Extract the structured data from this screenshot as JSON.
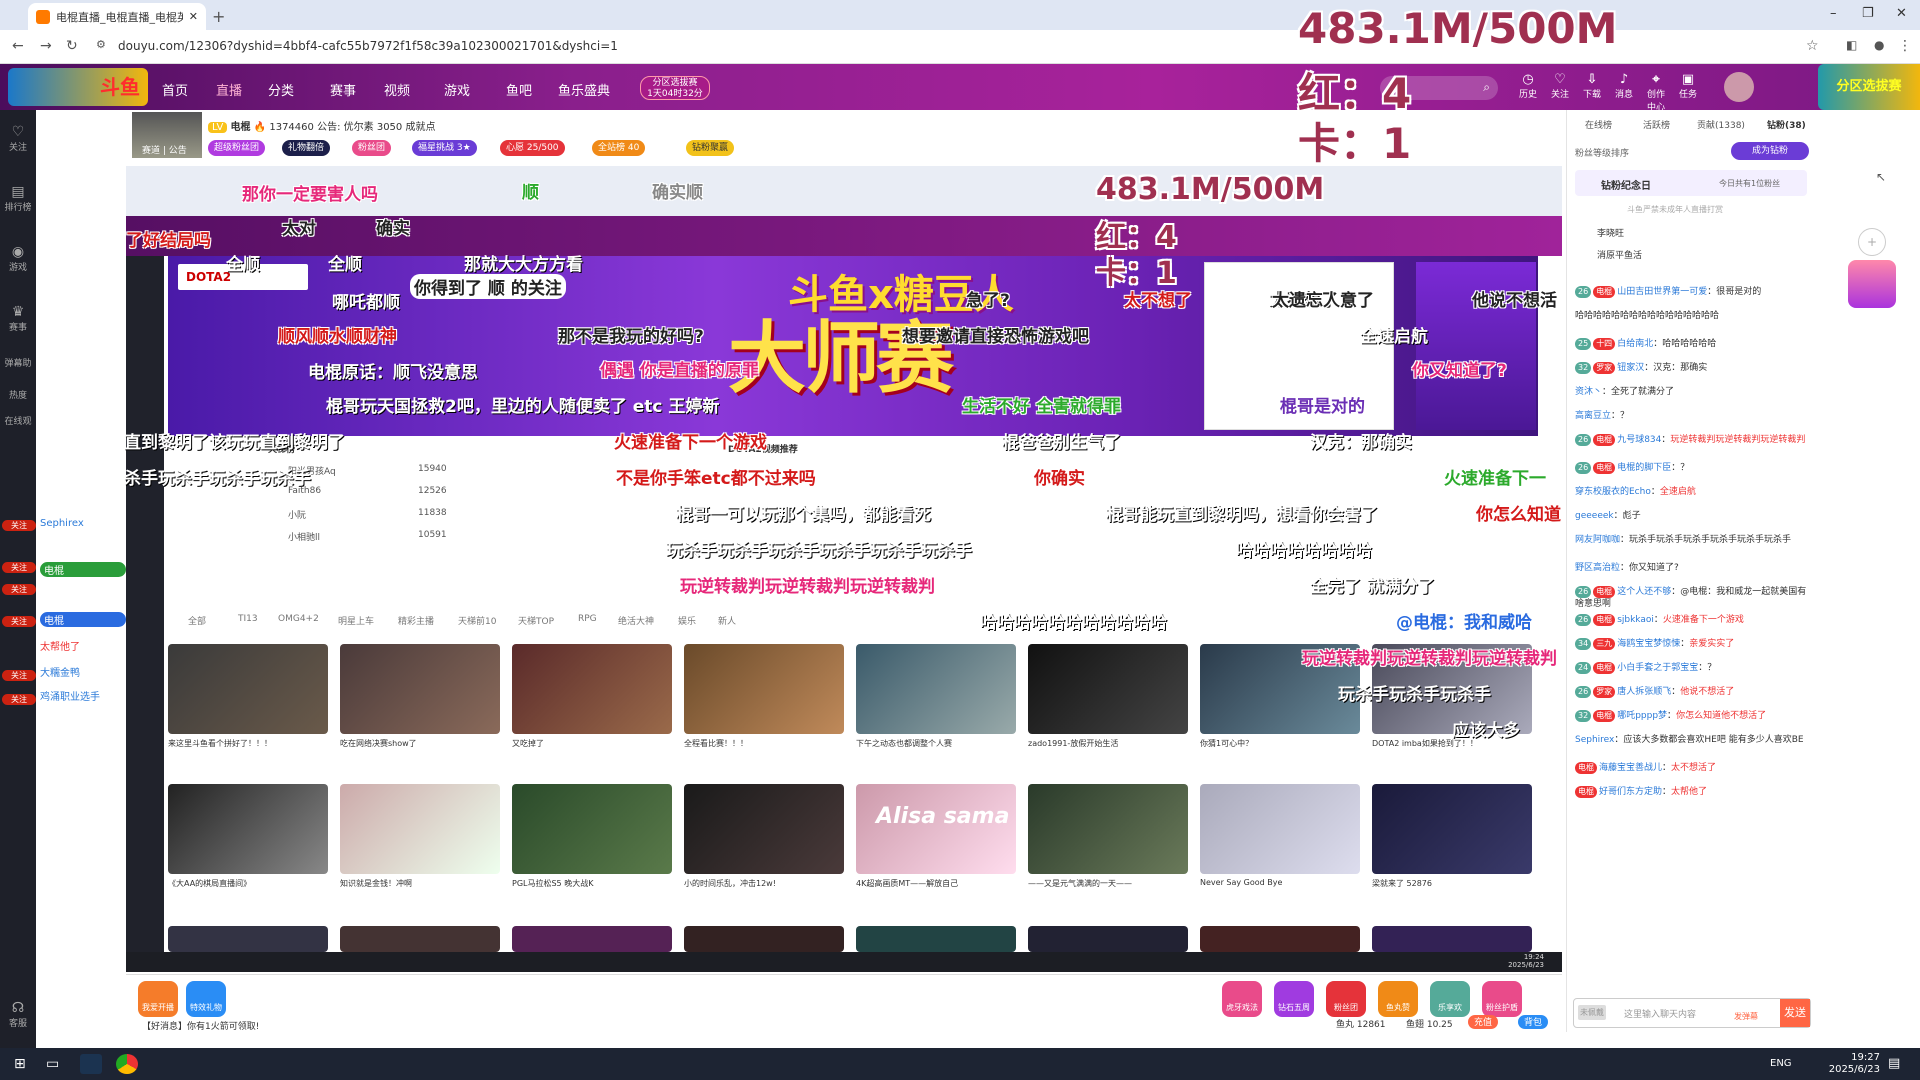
{
  "browser": {
    "tab_title": "电棍直播_电棍直播_电棍英雄l",
    "url": "douyu.com/12306?dyshid=4bbf4-cafc55b7972f1f58c39a102300021701&dyshci=1",
    "new_tab": "+",
    "win_min": "–",
    "win_max": "❐",
    "win_close": "✕"
  },
  "site_nav": {
    "logo": "斗鱼",
    "items": [
      "首页",
      "直播",
      "分类",
      "赛事",
      "视频",
      "游戏",
      "鱼吧",
      "鱼乐盛典"
    ],
    "fenqu": "分区选拔赛",
    "fenqu_time": "1天04时32分",
    "icons": [
      "历史",
      "关注",
      "下载",
      "消息",
      "创作中心",
      "任务"
    ]
  },
  "overlay_stats": {
    "traffic": "483.1M/500M",
    "red": "红：4",
    "card": "卡：1",
    "traffic_small": "483.1M/500M",
    "red_small": "红：4",
    "card_small": "卡：1"
  },
  "room": {
    "streamer": "电棍",
    "hot": "1374460",
    "notice": "公告: 优尔素",
    "fans": "3050 成就点",
    "tags": [
      "超级粉丝团",
      "礼物翻倍",
      "粉丝团",
      "福星挑战 3★",
      "心愿 25/500",
      "全站榜 40",
      "钻粉聚赢"
    ],
    "thumb_label": "赛道 | 公告"
  },
  "inner_page": {
    "dota_chip": "DOTA2",
    "banner_sub": "斗鱼x糖豆人",
    "banner_title": "大师赛",
    "rank_title": "天梯榜",
    "recommend_title": "DOTA2视频推荐",
    "rank_rows": [
      {
        "name": "阳光男孩Aq",
        "score": "15940"
      },
      {
        "name": "Faith86",
        "score": "12526"
      },
      {
        "name": "小阮",
        "score": "11838"
      },
      {
        "name": "小相驰ll",
        "score": "10591"
      }
    ],
    "cat_tabs": [
      "全部",
      "TI13",
      "OMG4+2",
      "明星上车",
      "精彩主播",
      "天梯前10",
      "天梯TOP",
      "RPG",
      "绝活大神",
      "娱乐",
      "新人"
    ],
    "thumbs_row1": [
      {
        "cap": "来这里斗鱼看个拼好了！！！"
      },
      {
        "cap": "吃在网络决赛show了"
      },
      {
        "cap": "又吃掉了"
      },
      {
        "cap": "全程看比赛！！！"
      },
      {
        "cap": "下午之动态也都调整个人赛"
      },
      {
        "cap": "zado1991-放假开始生活"
      },
      {
        "cap": "你猜1可心中？"
      },
      {
        "cap": "DOTA2 imba如果抢到了！！"
      }
    ],
    "thumbs_row2": [
      {
        "cap": "《大AA的棋局直播间》"
      },
      {
        "cap": "知识就是金钱！冲啊"
      },
      {
        "cap": "PGL马拉松S5 晚大战K"
      },
      {
        "cap": "小的时间乐乱，冲击12w!"
      },
      {
        "cap": "4K超高画质MT——解放自己"
      },
      {
        "cap": "——又是元气满满的一天——"
      },
      {
        "cap": "Never Say Good Bye"
      },
      {
        "cap": "梁就来了 52876"
      }
    ],
    "alisa": "Alisa sama",
    "inner_taskbar_time": "19:24",
    "inner_taskbar_date": "2025/6/23"
  },
  "danmaku": [
    "那你一定要害人吗",
    "顺",
    "确实顺",
    "了好结局吗",
    "太对",
    "确实",
    "全顺",
    "全顺",
    "那就大大方方看",
    "哪吒都顺",
    "你得到了 顺 的关注",
    "急了?",
    "太不想了",
    "太不想了",
    "他说不想活",
    "顺风顺水顺财神",
    "那不是我玩的好吗?",
    "想要邀请直接恐怖游戏吧",
    "太遗忘人意了",
    "全速启航",
    "电棍原话：顺飞没意思",
    "偶遇 你是直播的原罪",
    "你又知道了?",
    "棍哥玩天国拯救2吧，里边的人随便卖了 etc 王婷新",
    "生活不好 全害就得罪",
    "棍哥是对的",
    "直到黎明了该玩玩直到黎明了",
    "火速准备下一个游戏",
    "棍爸爸别生气了",
    "汉克：那确实",
    "杀手玩杀手玩杀手玩杀手",
    "不是你手笨etc都不过来吗",
    "你确实",
    "火速准备下一",
    "棍哥一可以玩那个集吗，都能看死",
    "棍哥能玩直到黎明吗，想看你会害了",
    "你怎么知道",
    "玩杀手玩杀手玩杀手玩杀手玩杀手玩杀手",
    "哈哈哈哈哈哈哈哈",
    "玩逆转裁判玩逆转裁判玩逆转裁判",
    "全完了 就满分了",
    "哈哈哈哈哈哈哈哈哈哈哈",
    "@电棍：我和威哈",
    "玩逆转裁判玩逆转裁判玩逆转裁判",
    "玩杀手玩杀手玩杀手",
    "应该大多",
    "哈哈哈哈哈哈"
  ],
  "gifts": [
    "我爱开播",
    "特效礼物",
    "虎牙戏法",
    "钻石五周",
    "粉丝团",
    "鱼丸赞",
    "乐享欢",
    "粉丝护盾"
  ],
  "giftbar": {
    "notice": "【好消息】你有1火箭可领取!",
    "fish": "鱼丸 12861",
    "fishbal": "鱼翅 10.25",
    "recharge": "充值",
    "bag": "背包"
  },
  "chat": {
    "tabs": [
      "在线榜",
      "活跃榜",
      "贡献(1338)",
      "钻粉(38)"
    ],
    "fan_rank": "粉丝等级排序",
    "diamond_btn": "成为钻粉",
    "diamond_day": "钻粉纪念日",
    "diamond_today": "今日共有1位粉丝",
    "diamond_note": "斗鱼严禁未成年人直播打赏",
    "rank1": "李晓旺",
    "rank2": "消原平鱼活",
    "messages": [
      {
        "lv": "26",
        "name": "山田吉田世界第一可爱",
        "text": "很哥是对的",
        "tag": "电棍"
      },
      {
        "lv": "",
        "name": "",
        "text": "哈哈哈哈哈哈哈哈哈哈哈哈哈哈哈哈",
        "tag": ""
      },
      {
        "lv": "25",
        "name": "白给南北",
        "text": "哈哈哈哈哈哈",
        "tag": "十四"
      },
      {
        "lv": "32",
        "name": "钮家汉",
        "text": "汉克：那确实",
        "tag": "罗家"
      },
      {
        "lv": "",
        "name": "资沐丶",
        "text": "全死了就满分了",
        "tag": ""
      },
      {
        "lv": "",
        "name": "高离豆立",
        "text": "？",
        "tag": ""
      },
      {
        "lv": "26",
        "name": "九号球834",
        "text": "玩逆转裁判玩逆转裁判玩逆转裁判",
        "tag": "电棍"
      },
      {
        "lv": "26",
        "name": "电棍的脚下臣",
        "text": "？",
        "tag": "电棍"
      },
      {
        "lv": "",
        "name": "穿东校服衣的Echo",
        "text": "全速启航",
        "tag": ""
      },
      {
        "lv": "",
        "name": "geeeeek",
        "text": "彪子",
        "tag": ""
      },
      {
        "lv": "",
        "name": "网友阿咖咖",
        "text": "玩杀手玩杀手玩杀手玩杀手玩杀手玩杀手",
        "tag": ""
      },
      {
        "lv": "",
        "name": "野区高治粒",
        "text": "你又知道了?",
        "tag": ""
      },
      {
        "lv": "26",
        "name": "这个人还不够",
        "text": "@电棍：我和威龙一起就美国有啥意思啊",
        "tag": "电棍"
      },
      {
        "lv": "26",
        "name": "sjbkkaoi",
        "text": "火速准备下一个游戏",
        "tag": "电棍"
      },
      {
        "lv": "34",
        "name": "海鸥宝宝梦惊悚",
        "text": "亲爱实实了",
        "tag": "三九"
      },
      {
        "lv": "24",
        "name": "小白手套之于郭宝宝",
        "text": "？",
        "tag": "电棍"
      },
      {
        "lv": "26",
        "name": "唐人拆张顺飞",
        "text": "他说不想活了",
        "tag": "罗家"
      },
      {
        "lv": "32",
        "name": "哪吒pppp梦",
        "text": "你怎么知道他不想活了",
        "tag": "电棍"
      },
      {
        "lv": "",
        "name": "Sephirex",
        "text": "应该大多数都会喜欢HE吧 能有多少人喜欢BE",
        "tag": ""
      },
      {
        "lv": "",
        "name": "海藤宝宝善战儿",
        "text": "太不想活了",
        "tag": "电棍"
      },
      {
        "lv": "",
        "name": "好哥们东方定助",
        "text": "太帮他了",
        "tag": "电棍"
      }
    ],
    "input_placeholder": "这里输入聊天内容",
    "send": "发送",
    "barrage_btn": "发弹幕",
    "unvip": "未佩戴"
  },
  "left_chat_ghost": [
    {
      "tag": "关注",
      "name": "Sephirex",
      "lv": "10"
    },
    {
      "tag": "电棍",
      "name": "海鸥宝宝梦",
      "lv": "7"
    },
    {
      "tag": "电棍",
      "name": "好哥",
      "lv": "22"
    },
    {
      "tag": "",
      "name": "太帮他了",
      "lv": ""
    },
    {
      "tag": "",
      "name": "大糯金鸭",
      "lv": ""
    },
    {
      "tag": "",
      "name": "鸡涌职业选手",
      "lv": ""
    }
  ],
  "sidebar": [
    "关注",
    "排行榜",
    "游戏",
    "赛事",
    "弹幕助",
    "热度",
    "在线观",
    "客服"
  ],
  "taskbar": {
    "lang": "ENG",
    "time": "19:27",
    "date": "2025/6/23"
  },
  "colors": {
    "header": "#8a1f8c",
    "danmaku_pink": "#e6287a",
    "danmaku_red": "#d41a1a",
    "danmaku_green": "#2caa2c",
    "danmaku_blue": "#2a6be0",
    "danmaku_purple": "#6b2fb5"
  }
}
